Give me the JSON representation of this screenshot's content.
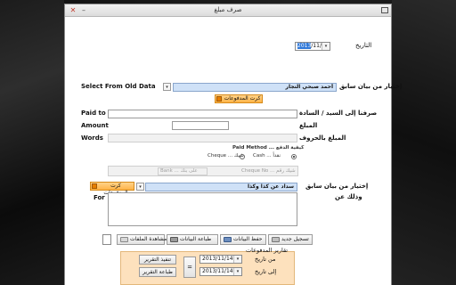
{
  "window": {
    "title": "صرف مبلغ"
  },
  "labels": {
    "date": "التاريخ",
    "select_from_old_data_ar": "إختيار من بيان سابق",
    "select_from_old_data_en": "Select From Old Data",
    "paid_to_ar": "صرفنا إلى السيد / السادة",
    "paid_to_en": "Paid to",
    "amount_ar": "المبلغ",
    "amount_en": "Amount",
    "words_ar": "المبلغ بالحروف",
    "words_en": "Words",
    "payment_method": "Paid Method ... كيفية الدفع",
    "cash": "Cash ... نقداً",
    "cheque": "Cheque ... شيك",
    "select_old_2": "إختيار من بيان سابق",
    "for_ar": "وذلك عن",
    "for_en": "For"
  },
  "fields": {
    "date_value_prefix": "2013",
    "date_value_suffix": "/11/14",
    "old_data_value": "أحمد صبحي النجار",
    "cheque_no_placeholder": "Cheque No ... شيك رقم",
    "bank_placeholder": "Bank ... على بنك",
    "old_data_2_value": "سداد عن كذا وكذا"
  },
  "buttons": {
    "payments_card_1": "كرت المدفوعات",
    "payments_card_2": "كرت المدفوعات",
    "new_record": "تسجيل جديد",
    "save_data": "حفظ البيانات",
    "print_data": "طباعة البيانات",
    "view_files": "مشاهدة الملفات",
    "execute_report": "تنفيذ التقرير",
    "print_report": "طباعة التقرير",
    "equals": "="
  },
  "report_panel": {
    "title": "تقارير المدفوعات",
    "from_label": "من تاريخ",
    "to_label": "إلى تاريخ",
    "from_date": "2013/11/14",
    "to_date": "2013/11/14"
  },
  "payment_method_selected": "cash"
}
